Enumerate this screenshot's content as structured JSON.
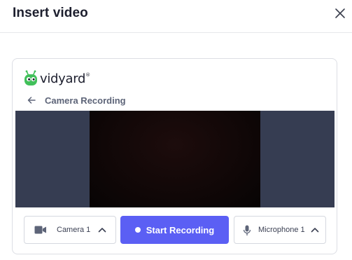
{
  "modal": {
    "title": "Insert video"
  },
  "brand": {
    "name": "vidyard",
    "trademark": "®",
    "logo_color": "#41c05a"
  },
  "recorder": {
    "back_label": "Camera Recording",
    "camera_select": {
      "value": "Camera 1",
      "icon": "video-camera-icon"
    },
    "start_button": {
      "label": "Start Recording",
      "color": "#5b5ff4"
    },
    "microphone_select": {
      "value": "Microphone 1",
      "icon": "microphone-icon"
    }
  }
}
